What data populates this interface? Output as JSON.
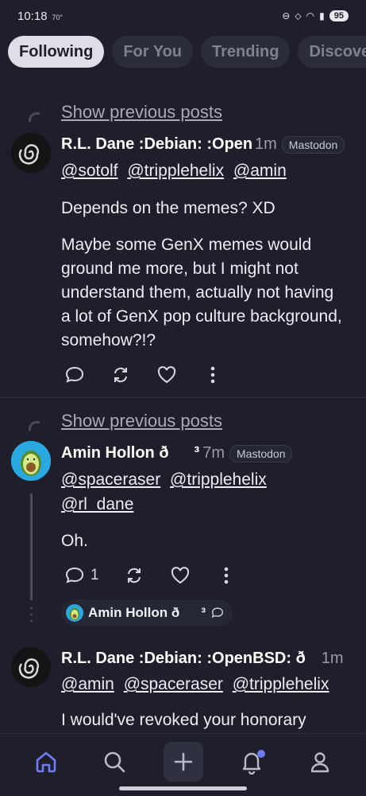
{
  "status_bar": {
    "time": "10:18",
    "temp": "70°",
    "battery": "95"
  },
  "tabs": [
    {
      "label": "Following",
      "active": true
    },
    {
      "label": "For You",
      "active": false
    },
    {
      "label": "Trending",
      "active": false
    },
    {
      "label": "Discover",
      "active": false
    }
  ],
  "posts": [
    {
      "show_previous": "Show previous posts",
      "author": "R.L. Dane :Debian: :OpenBSD:",
      "time": "1m",
      "badge": "Mastodon",
      "mentions": [
        "@sotolf",
        "@tripplehelix",
        "@amin"
      ],
      "paragraphs": [
        "Depends on the memes? XD",
        "Maybe some GenX memes would ground me more, but I might not understand them, actually not having a lot of GenX pop culture background, somehow?!?"
      ],
      "reply_count": ""
    },
    {
      "show_previous": "Show previous posts",
      "author": "Amin Hollon ð³",
      "time": "7m",
      "badge": "Mastodon",
      "mentions": [
        "@spaceraser",
        "@tripplehelix",
        "@rl_dane"
      ],
      "paragraphs": [
        "Oh."
      ],
      "reply_count": "1",
      "reply_chip": "Amin Hollon ð³"
    },
    {
      "author": "R.L. Dane :Debian: :OpenBSD: ð",
      "time": "1m",
      "mentions": [
        "@amin",
        "@spaceraser",
        "@tripplehelix"
      ],
      "paragraphs": [
        "I would've revoked your honorary"
      ]
    }
  ],
  "nav": [
    {
      "icon": "home-icon",
      "active": true
    },
    {
      "icon": "search-icon",
      "active": false
    },
    {
      "icon": "compose-icon",
      "active": false
    },
    {
      "icon": "notifications-icon",
      "active": false,
      "has_dot": true
    },
    {
      "icon": "profile-icon",
      "active": false
    }
  ],
  "colors": {
    "background": "#1e1f2b",
    "accent": "#6e7cf5",
    "tab_active_bg": "#dedfe6"
  }
}
